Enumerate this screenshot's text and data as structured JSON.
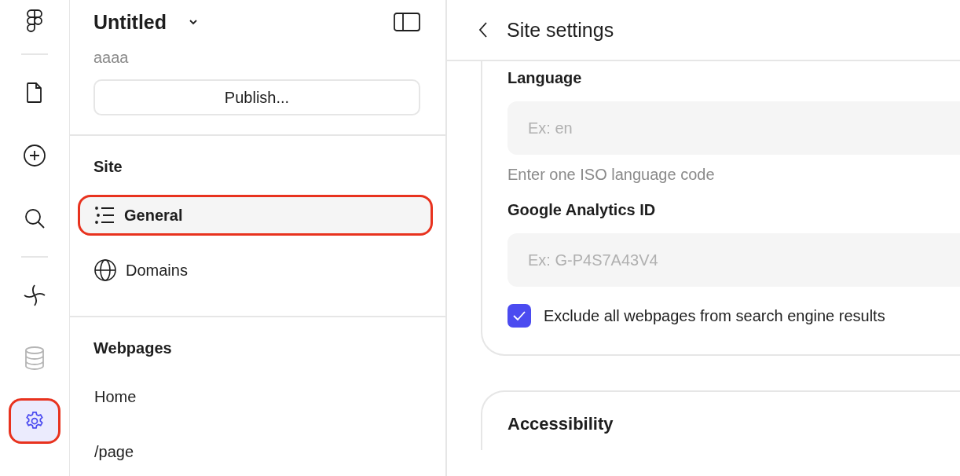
{
  "rail": {
    "items": [
      {
        "kind": "file",
        "selected": false,
        "disabled": false
      },
      {
        "kind": "add",
        "selected": false,
        "disabled": false
      },
      {
        "kind": "search",
        "selected": false,
        "disabled": false
      },
      {
        "kind": "sparkle",
        "selected": false,
        "disabled": false
      },
      {
        "kind": "database",
        "selected": false,
        "disabled": true
      },
      {
        "kind": "settings",
        "selected": true,
        "disabled": false
      }
    ]
  },
  "sidebar": {
    "title": "Untitled",
    "subtitle": "aaaa",
    "publish_button": "Publish...",
    "sections": [
      {
        "heading": "Site",
        "items": [
          {
            "label": "General",
            "selected": true
          },
          {
            "label": "Domains",
            "selected": false
          }
        ]
      },
      {
        "heading": "Webpages",
        "items": [
          {
            "label": "Home",
            "selected": false
          },
          {
            "label": "/page",
            "selected": false
          }
        ]
      }
    ]
  },
  "header": {
    "title": "Site settings"
  },
  "settings": {
    "fields": [
      {
        "label": "Language",
        "placeholder": "Ex: en",
        "help": "Enter one ISO language code"
      },
      {
        "label": "Google Analytics ID",
        "placeholder": "Ex: G-P4S7A43V4"
      }
    ],
    "checkbox": {
      "label": "Exclude all webpages from search engine results",
      "checked": true
    }
  },
  "next_section": {
    "heading": "Accessibility"
  }
}
